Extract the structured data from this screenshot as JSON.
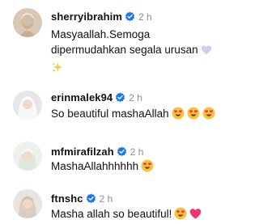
{
  "comments": [
    {
      "username": "sherryibrahim",
      "time": "2 h",
      "line1": "Masyaallah.Semoga",
      "line2": "dipermudahkan segala urusan",
      "emojis": [
        "heart-purple",
        "sparkles"
      ]
    },
    {
      "username": "erinmalek94",
      "time": "2 h",
      "text": "So beautiful mashaAllah",
      "emojis": [
        "heart-eyes",
        "heart-eyes",
        "heart-eyes"
      ]
    },
    {
      "username": "mfmirafilzah",
      "time": "2 h",
      "text": "MashaAllahhhhhh",
      "emojis": [
        "heart-eyes"
      ]
    },
    {
      "username": "ftnshc",
      "time": "2 h",
      "text": "Masha allah so beautiful!",
      "emojis": [
        "heart-eyes",
        "heart-pink"
      ]
    }
  ],
  "colors": {
    "verified": "#1877f2",
    "time": "#8e8e8e"
  }
}
